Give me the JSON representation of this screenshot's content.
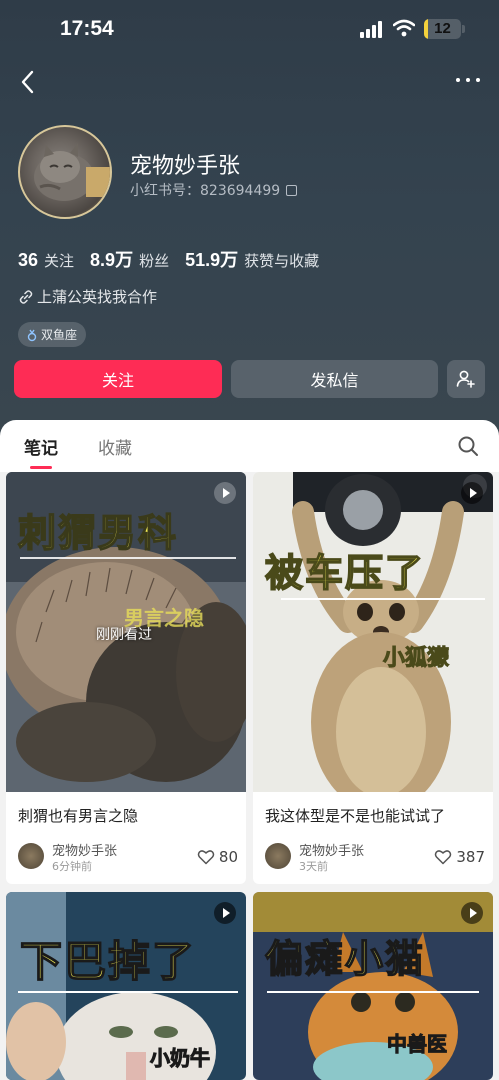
{
  "status_bar": {
    "time": "17:54",
    "battery": "12",
    "battery_level_pct": 12
  },
  "profile": {
    "nickname": "宠物妙手张",
    "redid": "小红书号：823694499",
    "stats": [
      {
        "num": "36",
        "label": "关注"
      },
      {
        "num": "8.9万",
        "label": "粉丝"
      },
      {
        "num": "51.9万",
        "label": "获赞与收藏"
      }
    ],
    "bio": "上蒲公英找我合作",
    "tag": "双鱼座"
  },
  "actions": {
    "follow": "关注",
    "message": "发私信"
  },
  "tabs": {
    "notes": "笔记",
    "collect": "收藏"
  },
  "notes": [
    {
      "cover_title": "刺猬男科",
      "cover_subtitle": "男言之隐",
      "viewed_label": "刚刚看过",
      "title": "刺猬也有男言之隐",
      "author": "宠物妙手张",
      "time": "6分钟前",
      "likes": "80"
    },
    {
      "cover_title": "被车压了",
      "cover_subtitle": "小狐獴",
      "title": "我这体型是不是也能试试了",
      "author": "宠物妙手张",
      "time": "3天前",
      "likes": "387"
    },
    {
      "cover_title": "下巴掉了",
      "cover_subtitle": "小奶牛"
    },
    {
      "cover_title": "偏瘫小猫",
      "cover_subtitle": "中兽医"
    }
  ]
}
